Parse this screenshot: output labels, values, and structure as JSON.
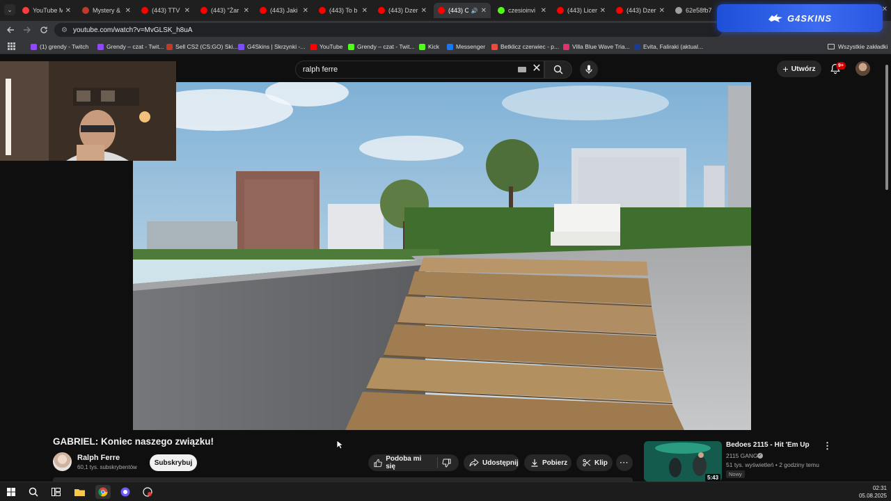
{
  "browser": {
    "tabs": [
      {
        "label": "YouTube M",
        "color": "#ff3b3b"
      },
      {
        "label": "Mystery &",
        "color": "#c0392b"
      },
      {
        "label": "(443) TTV",
        "color": "#ff0000"
      },
      {
        "label": "(443) \"Żar",
        "color": "#ff0000"
      },
      {
        "label": "(443) Jaki",
        "color": "#ff0000"
      },
      {
        "label": "(443) To b",
        "color": "#ff0000"
      },
      {
        "label": "(443) Dzer",
        "color": "#ff0000"
      },
      {
        "label": "(443) C",
        "color": "#ff0000"
      },
      {
        "label": "czesioinvi",
        "color": "#53fc18"
      },
      {
        "label": "(443) Licer",
        "color": "#ff0000"
      },
      {
        "label": "(443) Dzer",
        "color": "#ff0000"
      },
      {
        "label": "62e58fb7",
        "color": "#9aa0a6"
      }
    ],
    "url": "youtube.com/watch?v=MvGLSK_h8uA",
    "bookmarks": [
      {
        "label": "(1) grendy - Twitch",
        "color": "#9146ff"
      },
      {
        "label": "Grendy – czat - Twit...",
        "color": "#9146ff"
      },
      {
        "label": "Sell CS2 (CS:GO) Ski...",
        "color": "#c0392b"
      },
      {
        "label": "G4Skins | Skrzynki -...",
        "color": "#7b4dff"
      },
      {
        "label": "YouTube",
        "color": "#ff0000"
      },
      {
        "label": "Grendy – czat - Twit...",
        "color": "#53fc18"
      },
      {
        "label": "Kick",
        "color": "#53fc18"
      },
      {
        "label": "Messenger",
        "color": "#1877f2"
      },
      {
        "label": "Betklicz czerwiec - p...",
        "color": "#e74c3c"
      },
      {
        "label": "Villa Blue Wave Tria...",
        "color": "#e1306c"
      },
      {
        "label": "Evita, Faliraki (aktual...",
        "color": "#1a3b8f"
      }
    ],
    "all_bookmarks": "Wszystkie zakładki"
  },
  "overlay": {
    "brand": "G4SKINS"
  },
  "youtube": {
    "search_query": "ralph ferre",
    "create_label": "Utwórz",
    "notification_count": "9+",
    "video_title": "GABRIEL: Koniec naszego związku!",
    "channel_name": "Ralph Ferre",
    "channel_subs": "60,1 tys. subskrybentów",
    "subscribe_label": "Subskrybuj",
    "like_label": "Podoba mi się",
    "share_label": "Udostępnij",
    "download_label": "Pobierz",
    "clip_label": "Klip",
    "recommended": {
      "title": "Bedoes 2115 - Hit 'Em Up",
      "channel": "2115 GANG",
      "meta": "51 tys. wyświetleń • 2 godziny temu",
      "badge": "Nowy",
      "duration": "5:43"
    }
  },
  "taskbar": {
    "time": "02:31",
    "date": "05.08.2025"
  }
}
